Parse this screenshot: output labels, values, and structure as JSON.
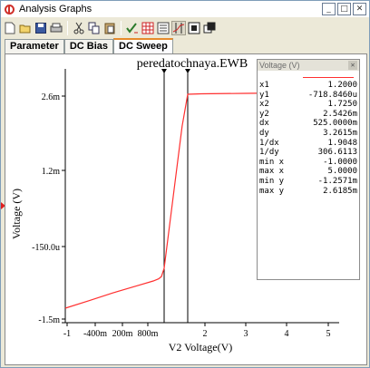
{
  "window": {
    "title": "Analysis Graphs"
  },
  "tabs": [
    {
      "label": "Parameter",
      "active": false
    },
    {
      "label": "DC Bias",
      "active": false
    },
    {
      "label": "DC Sweep",
      "active": true
    }
  ],
  "toolbar": {
    "icons": [
      "new-icon",
      "open-icon",
      "save-icon",
      "print-icon",
      "cut-icon",
      "copy-icon",
      "paste-icon",
      "properties-icon",
      "grid-icon",
      "legend-icon",
      "cursors-icon",
      "reverse-colors-icon",
      "restore-icon"
    ]
  },
  "colors": {
    "trace": "#ff3030",
    "cursor": "#000000",
    "tab_highlight": "#e68b2c"
  },
  "chart_data": {
    "type": "line",
    "title": "peredatochnaya.EWB",
    "xlabel": "V2 Voltage(V)",
    "ylabel": "Voltage (V)",
    "xlim": [
      -1,
      5
    ],
    "ylim": [
      -1.5,
      2.6
    ],
    "x_ticks": [
      "-1",
      "-400m",
      "200m",
      "800m",
      "2",
      "3",
      "4",
      "5"
    ],
    "y_ticks": [
      "-1.5m",
      "-150.0u",
      "1.2m",
      "2.6m"
    ],
    "grid": false,
    "series": [
      {
        "x": [
          -1.0,
          -0.5,
          0.0,
          0.5,
          0.8,
          1.0,
          1.1,
          1.2,
          1.4,
          1.6,
          1.725,
          2.0,
          3.0,
          4.0,
          5.0
        ],
        "y": [
          -1.2571,
          -1.13,
          -1.0,
          -0.88,
          -0.8,
          -0.73,
          -0.66,
          -0.4,
          0.8,
          2.0,
          2.5426,
          2.56,
          2.58,
          2.6,
          2.6185
        ]
      }
    ],
    "cursors_x": [
      1.2,
      1.725
    ]
  },
  "cursor_panel": {
    "title": "Voltage (V)",
    "rows": [
      {
        "label": "x1",
        "value": "1.2000"
      },
      {
        "label": "y1",
        "value": "-718.8460u"
      },
      {
        "label": "x2",
        "value": "1.7250"
      },
      {
        "label": "y2",
        "value": "2.5426m"
      },
      {
        "label": "dx",
        "value": "525.0000m"
      },
      {
        "label": "dy",
        "value": "3.2615m"
      },
      {
        "label": "1/dx",
        "value": "1.9048"
      },
      {
        "label": "1/dy",
        "value": "306.6113"
      },
      {
        "label": "min x",
        "value": "-1.0000"
      },
      {
        "label": "max x",
        "value": "5.0000"
      },
      {
        "label": "min y",
        "value": "-1.2571m"
      },
      {
        "label": "max y",
        "value": "2.6185m"
      }
    ]
  }
}
